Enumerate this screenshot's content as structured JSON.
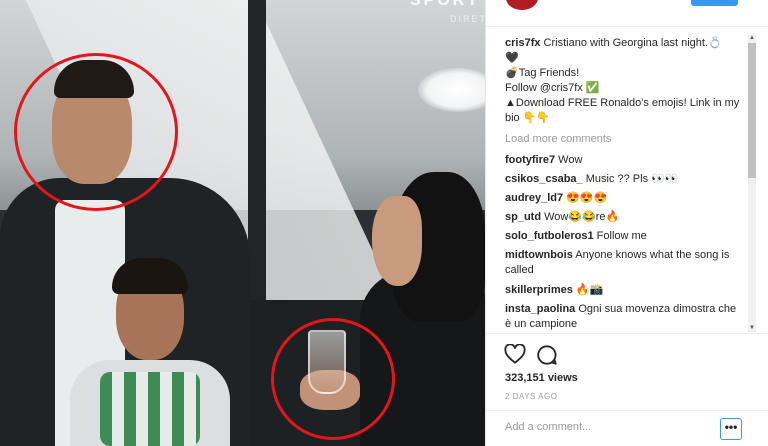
{
  "photo": {
    "brand": "SPORT",
    "brand_sub": "DIRET"
  },
  "comments_panel": {
    "caption": {
      "user": "cris7fx",
      "lines": [
        " Cristiano with Georgina last night.💍",
        "🖤",
        "💣Tag Friends!",
        "Follow @cris7fx ✅",
        "▲Download FREE Ronaldo's emojis! Link in my bio 👇👇"
      ]
    },
    "load_more": "Load more comments",
    "comments": [
      {
        "user": "footyfire7",
        "text": " Wow"
      },
      {
        "user": "csikos_csaba_",
        "text": " Music ?? Pls 👀👀"
      },
      {
        "user": "audrey_ld7",
        "text": " 😍😍😍"
      },
      {
        "user": "sp_utd",
        "text": " Wow😂😂re🔥"
      },
      {
        "user": "solo_futboleros1",
        "text": " Follow me"
      },
      {
        "user": "midtownbois",
        "text": " Anyone knows what the song is called"
      },
      {
        "user": "skillerprimes",
        "text": " 🔥📸"
      },
      {
        "user": "insta_paolina",
        "text": " Ogni sua movenza dimostra che è un campione"
      }
    ],
    "views": "323,151 views",
    "date": "2 DAYS AGO",
    "comment_placeholder": "Add a comment...",
    "more_label": "•••"
  },
  "icons": {
    "like": "heart-icon",
    "comment": "comment-bubble-icon"
  },
  "colors": {
    "circle_highlight": "#e3161c",
    "accent": "#3897f0"
  }
}
